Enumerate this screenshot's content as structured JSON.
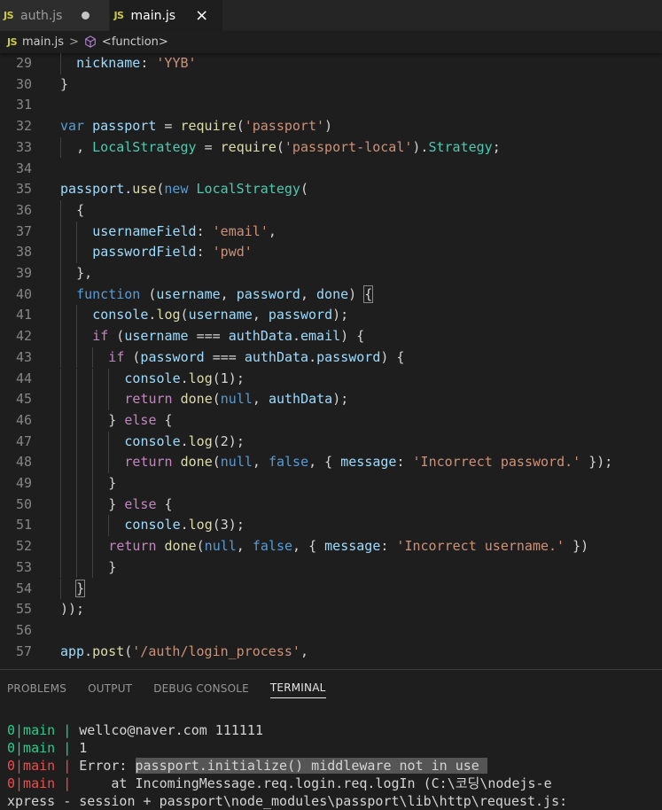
{
  "tabs": [
    {
      "badge": "JS",
      "label": "auth.js",
      "modified": true
    },
    {
      "badge": "JS",
      "label": "main.js",
      "close": "×"
    }
  ],
  "breadcrumb": {
    "badge": "JS",
    "file": "main.js",
    "separator": ">",
    "symbol": "<function>"
  },
  "editor": {
    "lines": [
      {
        "n": "29",
        "indent": 1,
        "html": "<span class='v'>nickname</span><span class='p'>: </span><span class='s'>'YYB'</span>"
      },
      {
        "n": "30",
        "indent": 0,
        "html": "<span class='p'>}</span>"
      },
      {
        "n": "31",
        "indent": 0,
        "html": ""
      },
      {
        "n": "32",
        "indent": 0,
        "html": "<span class='k'>var</span> <span class='v'>passport</span> <span class='p'>= </span><span class='f'>require</span><span class='p'>(</span><span class='s'>'passport'</span><span class='p'>)</span>"
      },
      {
        "n": "33",
        "indent": 1,
        "html": "<span class='p'>, </span><span class='t'>LocalStrategy</span><span class='p'> = </span><span class='f'>require</span><span class='p'>(</span><span class='s'>'passport-local'</span><span class='p'>).</span><span class='t'>Strategy</span><span class='p'>;</span>"
      },
      {
        "n": "34",
        "indent": 0,
        "html": ""
      },
      {
        "n": "35",
        "indent": 0,
        "html": "<span class='v'>passport</span><span class='p'>.</span><span class='f'>use</span><span class='p'>(</span><span class='k'>new</span> <span class='t'>LocalStrategy</span><span class='p'>(</span>"
      },
      {
        "n": "36",
        "indent": 1,
        "html": "<span class='p'>{</span>"
      },
      {
        "n": "37",
        "indent": 2,
        "html": "<span class='v'>usernameField</span><span class='p'>: </span><span class='s'>'email'</span><span class='p'>,</span>"
      },
      {
        "n": "38",
        "indent": 2,
        "html": "<span class='v'>passwordField</span><span class='p'>: </span><span class='s'>'pwd'</span>"
      },
      {
        "n": "39",
        "indent": 1,
        "html": "<span class='p'>},</span>"
      },
      {
        "n": "40",
        "indent": 1,
        "html": "<span class='k'>function</span> <span class='p'>(</span><span class='v'>username</span><span class='p'>, </span><span class='v'>password</span><span class='p'>, </span><span class='v'>done</span><span class='p'>) </span><span class='p bracket'>{</span>"
      },
      {
        "n": "41",
        "indent": 2,
        "html": "<span class='v'>console</span><span class='p'>.</span><span class='f'>log</span><span class='p'>(</span><span class='v'>username</span><span class='p'>, </span><span class='v'>password</span><span class='p'>);</span>"
      },
      {
        "n": "42",
        "indent": 2,
        "html": "<span class='c'>if</span> <span class='p'>(</span><span class='v'>username</span><span class='p'> === </span><span class='v'>authData</span><span class='p'>.</span><span class='v'>email</span><span class='p'>) {</span>"
      },
      {
        "n": "43",
        "indent": 3,
        "html": "<span class='c'>if</span> <span class='p'>(</span><span class='v'>password</span><span class='p'> === </span><span class='v'>authData</span><span class='p'>.</span><span class='v'>password</span><span class='p'>) {</span>"
      },
      {
        "n": "44",
        "indent": 4,
        "html": "<span class='v'>console</span><span class='p'>.</span><span class='f'>log</span><span class='p'>(</span><span class='p'>1</span><span class='p'>);</span>"
      },
      {
        "n": "45",
        "indent": 4,
        "html": "<span class='c'>return</span> <span class='f'>done</span><span class='p'>(</span><span class='k'>null</span><span class='p'>, </span><span class='v'>authData</span><span class='p'>);</span>"
      },
      {
        "n": "46",
        "indent": 3,
        "html": "<span class='p'>} </span><span class='c'>else</span><span class='p'> {</span>"
      },
      {
        "n": "47",
        "indent": 4,
        "html": "<span class='v'>console</span><span class='p'>.</span><span class='f'>log</span><span class='p'>(</span><span class='p'>2</span><span class='p'>);</span>"
      },
      {
        "n": "48",
        "indent": 4,
        "html": "<span class='c'>return</span> <span class='f'>done</span><span class='p'>(</span><span class='k'>null</span><span class='p'>, </span><span class='k'>false</span><span class='p'>, { </span><span class='v'>message</span><span class='p'>: </span><span class='s'>'Incorrect password.'</span><span class='p'> });</span>"
      },
      {
        "n": "49",
        "indent": 3,
        "html": "<span class='p'>}</span>"
      },
      {
        "n": "50",
        "indent": 3,
        "html": "<span class='p'>} </span><span class='c'>else</span><span class='p'> {</span>"
      },
      {
        "n": "51",
        "indent": 4,
        "html": "<span class='v'>console</span><span class='p'>.</span><span class='f'>log</span><span class='p'>(</span><span class='p'>3</span><span class='p'>);</span>"
      },
      {
        "n": "52",
        "indent": 3,
        "html": "<span class='c'>return</span> <span class='f'>done</span><span class='p'>(</span><span class='k'>null</span><span class='p'>, </span><span class='k'>false</span><span class='p'>, { </span><span class='v'>message</span><span class='p'>: </span><span class='s'>'Incorrect username.'</span><span class='p'> })</span>"
      },
      {
        "n": "53",
        "indent": 3,
        "html": "<span class='p'>}</span>"
      },
      {
        "n": "54",
        "indent": 1,
        "html": "<span class='p bracket'>}</span>"
      },
      {
        "n": "55",
        "indent": 0,
        "html": "<span class='p'>));</span>"
      },
      {
        "n": "56",
        "indent": 0,
        "html": ""
      },
      {
        "n": "57",
        "indent": 0,
        "html": "<span class='v'>app</span><span class='p'>.</span><span class='f'>post</span><span class='p'>(</span><span class='s'>'/auth/login_process'</span><span class='p'>,</span>"
      }
    ]
  },
  "panel": {
    "tabs": [
      "PROBLEMS",
      "OUTPUT",
      "DEBUG CONSOLE",
      "TERMINAL"
    ],
    "active": "TERMINAL",
    "terminal": [
      {
        "prefix": "0|main",
        "text": "wellco@naver.com 111111",
        "error": false
      },
      {
        "prefix": "0|main",
        "text": "1",
        "error": false
      },
      {
        "prefix": "0|main",
        "text": "Error: ",
        "hl": "passport.initialize() middleware not in use ",
        "error": true
      },
      {
        "prefix": "0|main",
        "text": "    at IncomingMessage.req.login.req.logIn (C:\\코딩\\nodejs-e",
        "error": true
      },
      {
        "prefix": "",
        "text": "xpress - session + passport\\node_modules\\passport\\lib\\http\\request.js:",
        "error": false
      }
    ]
  }
}
